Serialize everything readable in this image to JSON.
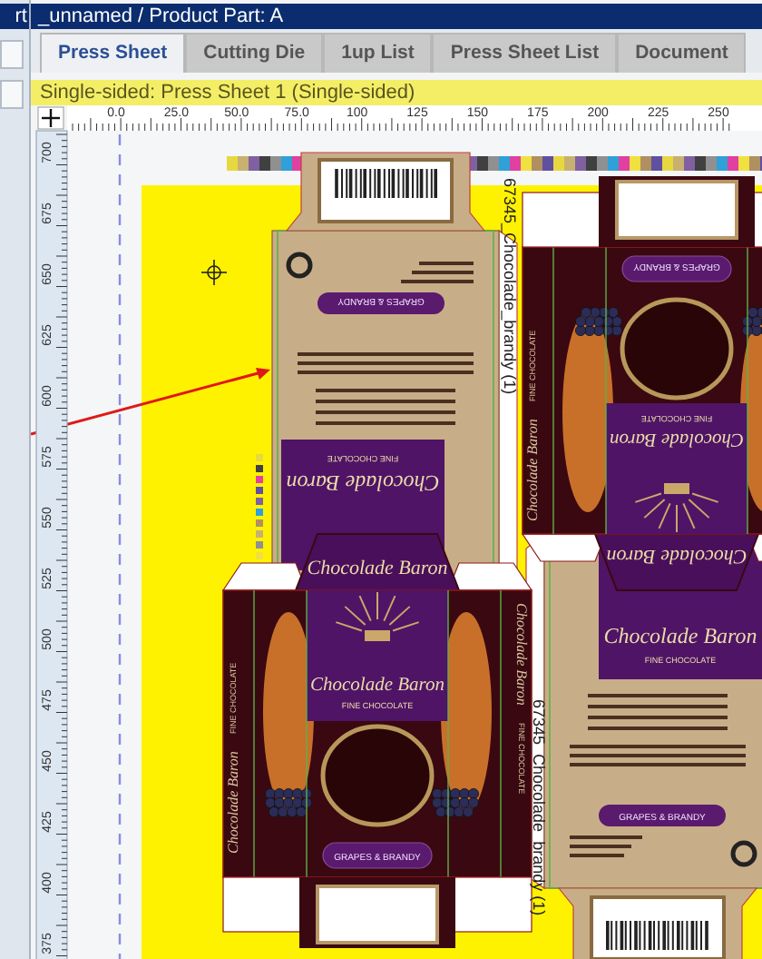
{
  "side_panel": {
    "title": "rt"
  },
  "window": {
    "title": "_unnamed / Product Part: A"
  },
  "tabs": [
    {
      "label": "Press Sheet",
      "selected": true
    },
    {
      "label": "Cutting Die",
      "selected": false
    },
    {
      "label": "1up List",
      "selected": false
    },
    {
      "label": "Press Sheet List",
      "selected": false
    },
    {
      "label": "Document",
      "selected": false
    }
  ],
  "status": "Single-sided:  Press Sheet 1 (Single-sided)",
  "ruler": {
    "horizontal": [
      "0.0",
      "25.0",
      "50.0",
      "75.0",
      "100",
      "125",
      "150",
      "175",
      "200",
      "225",
      "250"
    ],
    "vertical": [
      "700",
      "675",
      "650",
      "625",
      "600",
      "575",
      "550",
      "525",
      "500",
      "475",
      "450",
      "425",
      "400",
      "375"
    ]
  },
  "boxes": [
    {
      "kind": "back",
      "flipped": true,
      "title": "Chocolade Baron",
      "subtitle": "FINE CHOCOLATE",
      "flavor": "GRAPES & BRANDY"
    },
    {
      "kind": "front",
      "flipped": true,
      "title": "Chocolade Baron",
      "subtitle": "FINE CHOCOLATE",
      "flavor": "GRAPES & BRANDY",
      "flap_title": "Chocolade Baron",
      "side_labels": [
        {
          "text": "Chocolade Baron",
          "kind": "right"
        },
        {
          "text": "FINE CHOCOLATE",
          "kind": "right-sub"
        }
      ]
    },
    {
      "kind": "front",
      "flipped": false,
      "title": "Chocolade Baron",
      "subtitle": "FINE CHOCOLATE",
      "flavor": "GRAPES & BRANDY",
      "flap_title": "Chocolade Baron",
      "side_labels": [
        {
          "text": "Chocolade Baron",
          "kind": "left"
        },
        {
          "text": "FINE CHOCOLATE",
          "kind": "left-sub"
        },
        {
          "text": "Chocolade Baron",
          "kind": "right"
        },
        {
          "text": "FINE CHOCOLATE",
          "kind": "right-sub"
        }
      ]
    },
    {
      "kind": "back",
      "flipped": false,
      "title": "Chocolade Baron",
      "subtitle": "FINE CHOCOLATE",
      "flavor": "GRAPES & BRANDY"
    }
  ],
  "die_labels": [
    "67345_Chocolade_brandy (1)",
    "67345_Chocolade_brandy (1)"
  ]
}
